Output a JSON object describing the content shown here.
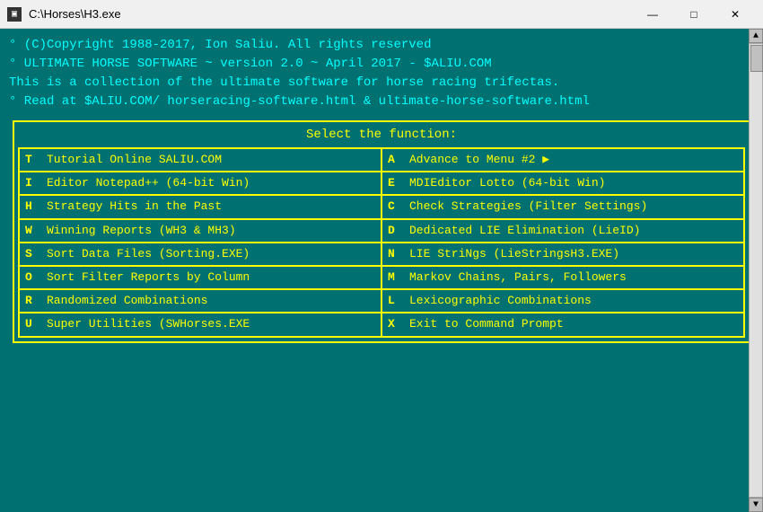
{
  "window": {
    "title": "C:\\Horses\\H3.exe",
    "icon": "▣"
  },
  "title_controls": {
    "minimize": "—",
    "maximize": "□",
    "close": "✕"
  },
  "header": {
    "lines": [
      "° (C)Copyright 1988-2017, Ion Saliu. All rights reserved",
      "° ULTIMATE HORSE SOFTWARE ~ version 2.0 ~ April 2017 - $ALIU.COM",
      "  This is a collection of the ultimate software for horse racing trifectas.",
      "° Read at $ALIU.COM/ horseracing-software.html & ultimate-horse-software.html"
    ]
  },
  "menu": {
    "title": "Select the function:",
    "items_left": [
      {
        "key": "T",
        "label": "Tutorial Online SALIU.COM"
      },
      {
        "key": "I",
        "label": "Editor Notepad++ (64-bit Win)"
      },
      {
        "key": "H",
        "label": "Strategy Hits in the Past"
      },
      {
        "key": "W",
        "label": "Winning Reports (WH3 & MH3)"
      },
      {
        "key": "S",
        "label": "Sort Data Files (Sorting.EXE)"
      },
      {
        "key": "O",
        "label": "Sort Filter Reports by Column"
      },
      {
        "key": "R",
        "label": "Randomized Combinations"
      },
      {
        "key": "U",
        "label": "Super Utilities (SWHorses.EXE"
      }
    ],
    "items_right": [
      {
        "key": "A",
        "label": "Advance to Menu #2 ▶"
      },
      {
        "key": "E",
        "label": "MDIEditor Lotto (64-bit Win)"
      },
      {
        "key": "C",
        "label": "Check Strategies (Filter Settings)"
      },
      {
        "key": "D",
        "label": "Dedicated LIE Elimination (LieID)"
      },
      {
        "key": "N",
        "label": "LIE StriNgs (LieStringsH3.EXE)"
      },
      {
        "key": "M",
        "label": "Markov Chains, Pairs, Followers"
      },
      {
        "key": "L",
        "label": "Lexicographic Combinations"
      },
      {
        "key": "X",
        "label": "Exit to Command Prompt"
      }
    ]
  }
}
